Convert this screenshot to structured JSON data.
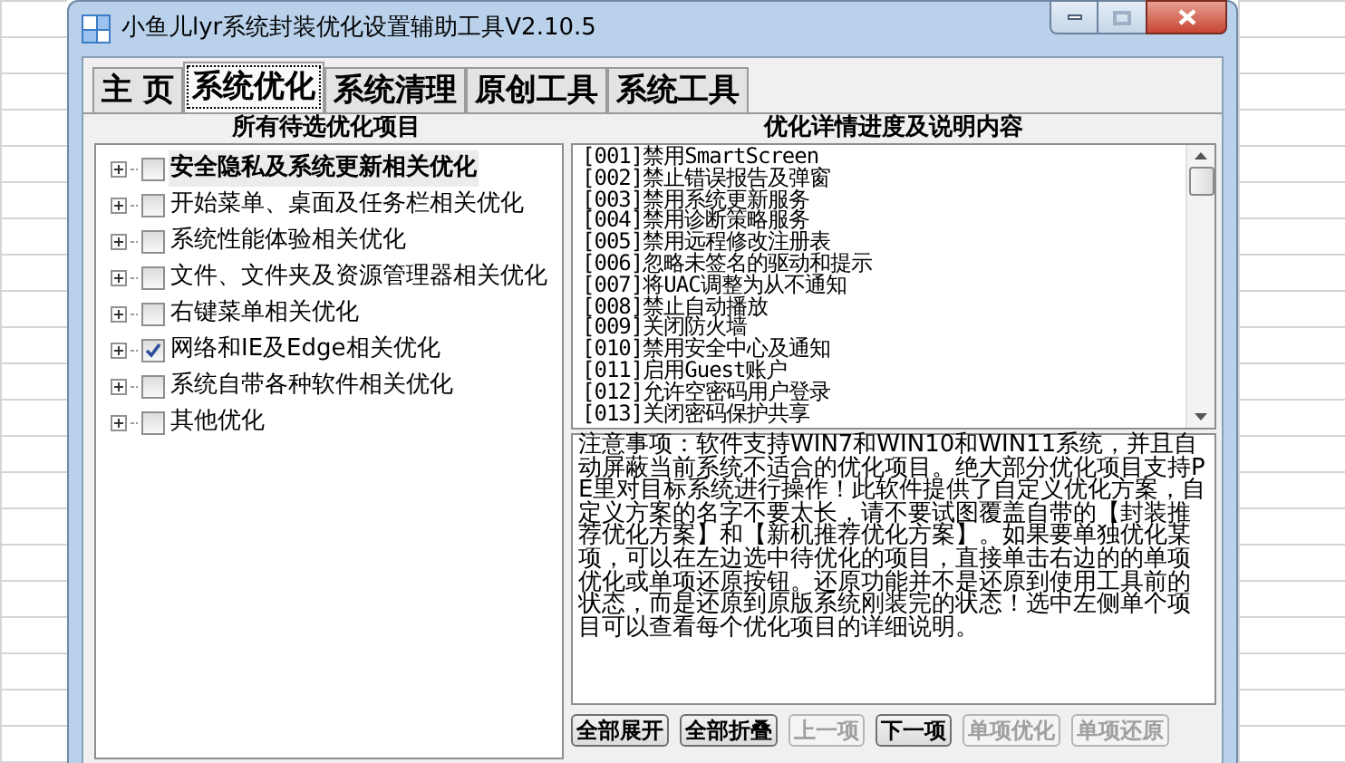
{
  "window": {
    "title": "小鱼儿lyr系统封装优化设置辅助工具V2.10.5"
  },
  "tabs": [
    {
      "label": "主 页",
      "selected": false
    },
    {
      "label": "系统优化",
      "selected": true
    },
    {
      "label": "系统清理",
      "selected": false
    },
    {
      "label": "原创工具",
      "selected": false
    },
    {
      "label": "系统工具",
      "selected": false
    }
  ],
  "left_panel": {
    "title": "所有待选优化项目",
    "items": [
      {
        "label": "安全隐私及系统更新相关优化",
        "checked": false,
        "selected": true,
        "expanded": false
      },
      {
        "label": "开始菜单、桌面及任务栏相关优化",
        "checked": false,
        "selected": false,
        "expanded": false
      },
      {
        "label": "系统性能体验相关优化",
        "checked": false,
        "selected": false,
        "expanded": false
      },
      {
        "label": "文件、文件夹及资源管理器相关优化",
        "checked": false,
        "selected": false,
        "expanded": false
      },
      {
        "label": "右键菜单相关优化",
        "checked": false,
        "selected": false,
        "expanded": false
      },
      {
        "label": "网络和IE及Edge相关优化",
        "checked": true,
        "selected": false,
        "expanded": false
      },
      {
        "label": "系统自带各种软件相关优化",
        "checked": false,
        "selected": false,
        "expanded": false
      },
      {
        "label": "其他优化",
        "checked": false,
        "selected": false,
        "expanded": false
      }
    ]
  },
  "right_panel": {
    "title": "优化详情进度及说明内容",
    "list": [
      "[001]禁用SmartScreen",
      "[002]禁止错误报告及弹窗",
      "[003]禁用系统更新服务",
      "[004]禁用诊断策略服务",
      "[005]禁用远程修改注册表",
      "[006]忽略未签名的驱动和提示",
      "[007]将UAC调整为从不通知",
      "[008]禁止自动播放",
      "[009]关闭防火墙",
      "[010]禁用安全中心及通知",
      "[011]启用Guest账户",
      "[012]允许空密码用户登录",
      "[013]关闭密码保护共享"
    ],
    "notes": "注意事项：软件支持WIN7和WIN10和WIN11系统，并且自动屏蔽当前系统不适合的优化项目。绝大部分优化项目支持PE里对目标系统进行操作！此软件提供了自定义优化方案，自定义方案的名字不要太长，请不要试图覆盖自带的【封装推荐优化方案】和【新机推荐优化方案】。如果要单独优化某项，可以在左边选中待优化的项目，直接单击右边的的单项优化或单项还原按钮。还原功能并不是还原到使用工具前的状态，而是还原到原版系统刚装完的状态！选中左侧单个项目可以查看每个优化项目的详细说明。"
  },
  "buttons": [
    {
      "label": "全部展开",
      "disabled": false
    },
    {
      "label": "全部折叠",
      "disabled": false
    },
    {
      "label": "上一项",
      "disabled": true
    },
    {
      "label": "下一项",
      "disabled": false
    },
    {
      "label": "单项优化",
      "disabled": true
    },
    {
      "label": "单项还原",
      "disabled": true
    }
  ]
}
